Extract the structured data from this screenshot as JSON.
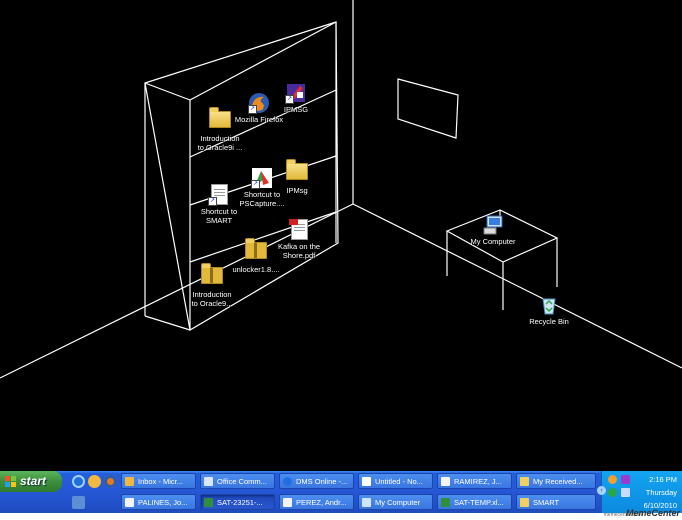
{
  "desktop": {
    "icons": [
      {
        "label": "Introduction\nto Oracle9i ...",
        "kind": "folder"
      },
      {
        "label": "Mozilla Firefox",
        "kind": "firefox"
      },
      {
        "label": "IPMSG",
        "kind": "ipmsg"
      },
      {
        "label": "Shortcut to\nSMART",
        "kind": "doc"
      },
      {
        "label": "Shortcut to\nPSCapture....",
        "kind": "pscapture"
      },
      {
        "label": "IPMsg",
        "kind": "folder"
      },
      {
        "label": "unlocker1.8....",
        "kind": "zip"
      },
      {
        "label": "Kafka on the\nShore.pdf",
        "kind": "pdf"
      },
      {
        "label": "Introduction\nto Oracle9...",
        "kind": "zip"
      },
      {
        "label": "My Computer",
        "kind": "computer"
      },
      {
        "label": "Recycle Bin",
        "kind": "recycle"
      }
    ]
  },
  "taskbar": {
    "start_label": "start",
    "row1": [
      {
        "label": "Inbox - Micr...",
        "icon": "outlook"
      },
      {
        "label": "Office Comm...",
        "icon": "office"
      },
      {
        "label": "DMS Online -...",
        "icon": "ie"
      },
      {
        "label": "Untitled - No...",
        "icon": "notepad"
      },
      {
        "label": "RAMIREZ, J...",
        "icon": "chat"
      },
      {
        "label": "My Received...",
        "icon": "folder"
      }
    ],
    "row2": [
      {
        "label": "PALINES, Jo...",
        "icon": "chat"
      },
      {
        "label": "SAT-23251-...",
        "icon": "excel"
      },
      {
        "label": "PEREZ, Andr...",
        "icon": "chat"
      },
      {
        "label": "My Computer",
        "icon": "computer"
      },
      {
        "label": "SAT-TEMP.xl...",
        "icon": "excel"
      },
      {
        "label": "SMART",
        "icon": "folder"
      }
    ],
    "clock": {
      "time": "2:16 PM",
      "day": "Thursday",
      "date": "6/10/2010"
    }
  },
  "watermark": {
    "site": "memecenter.com",
    "brand": "MemeCenter"
  },
  "colors": {
    "taskbar": "#245edb",
    "start": "#3c8f3c",
    "tray": "#0c8ae0",
    "wire": "#ffffff"
  }
}
